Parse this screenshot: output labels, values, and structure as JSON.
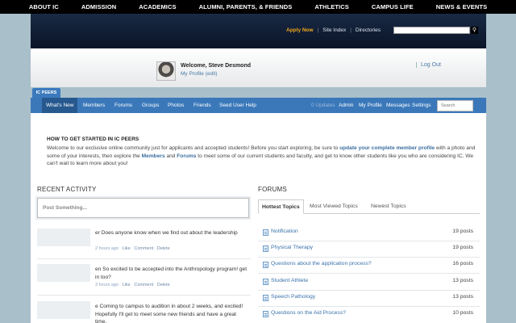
{
  "top_nav": [
    "ABOUT IC",
    "ADMISSION",
    "ACADEMICS",
    "ALUMNI, PARENTS, & FRIENDS",
    "ATHLETICS",
    "CAMPUS LIFE",
    "NEWS & EVENTS"
  ],
  "utility": {
    "apply": "Apply Now",
    "site_index": "Site Index",
    "directories": "Directories",
    "separator": "|"
  },
  "profile": {
    "welcome": "Welcome, Steve Desmond",
    "my_profile": "My Profile (edit)",
    "logout": "Log Out"
  },
  "peers_tab": "IC PEERS",
  "subnav": {
    "left": [
      "What's New",
      "Members",
      "Forums",
      "Groups",
      "Photos",
      "Friends",
      "Seed User Help"
    ],
    "updates": "0 Updates",
    "right": [
      "Admin",
      "My Profile",
      "Messages",
      "Settings"
    ],
    "search_placeholder": "Search"
  },
  "intro": {
    "title": "HOW TO GET STARTED IN IC PEERS",
    "text1": "Welcome to our exclusive online community just for applicants and accepted students! Before you start exploring, be sure to ",
    "link1": "update your complete member profile",
    "text2": " with a photo and some of your interests, then explore the ",
    "link2": "Members",
    "text3": " and ",
    "link3": "Forums",
    "text4": " to meet some of our current students and faculty, and get to know other students like you who are considering IC. We can't wait to learn more about you!"
  },
  "recent_activity": {
    "title": "RECENT ACTIVITY",
    "post_placeholder": "Post Something...",
    "items": [
      {
        "text": "er Does anyone know when we find out about the leadership",
        "time": "2 hours ago",
        "like": "Like",
        "comment": "Comment",
        "delete": "Delete"
      },
      {
        "text": "en So excited to be accepted into the Anthropology program! get in too?",
        "time": "3 hours ago",
        "like": "Like",
        "comment": "Comment",
        "delete": "Delete"
      },
      {
        "text": "e Coming to campus to audition in about 2 weeks, and excited! Hopefully I'll get to meet some new friends and have a great time.",
        "time": "",
        "like": "",
        "comment": "",
        "delete": ""
      }
    ]
  },
  "forums": {
    "title": "FORUMS",
    "tabs": [
      "Hottest Topics",
      "Most Viewed Topics",
      "Newest Topics"
    ],
    "topics": [
      {
        "name": "Notification",
        "posts": "19 posts"
      },
      {
        "name": "Physical Therapy",
        "posts": "19 posts"
      },
      {
        "name": "Questions about the application process?",
        "posts": "16 posts"
      },
      {
        "name": "Student Athlete",
        "posts": "13 posts"
      },
      {
        "name": "Speech Pathology",
        "posts": "13 posts"
      },
      {
        "name": "Questions on the Aid Process?",
        "posts": "10 posts"
      }
    ]
  }
}
